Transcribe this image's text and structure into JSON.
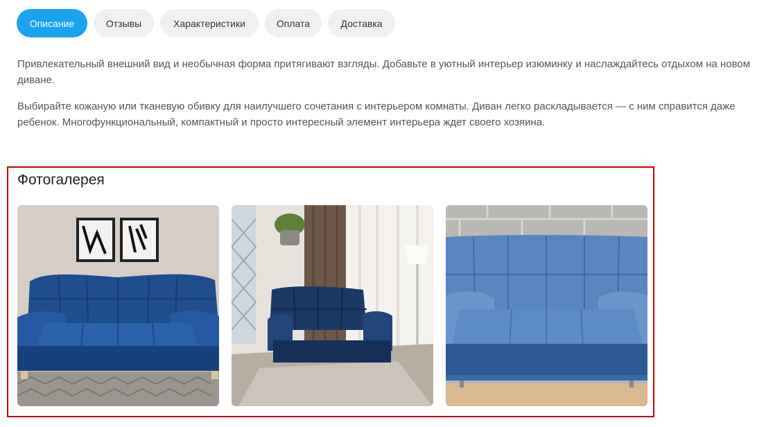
{
  "tabs": [
    {
      "label": "Описание",
      "active": true
    },
    {
      "label": "Отзывы",
      "active": false
    },
    {
      "label": "Характеристики",
      "active": false
    },
    {
      "label": "Оплата",
      "active": false
    },
    {
      "label": "Доставка",
      "active": false
    }
  ],
  "description": {
    "paragraphs": [
      "Привлекательный внешний вид и необычная форма притягивают взгляды. Добавьте в уютный интерьер изюминку и наслаждайтесь отдыхом на новом диване.",
      "Выбирайте кожаную или тканевую обивку для наилучшего сочетания с интерьером комнаты. Диван легко раскладывается — с ним справится даже ребенок. Многофункциональный, компактный и просто интересный элемент интерьера ждет своего хозяина."
    ]
  },
  "gallery": {
    "title": "Фотогалерея",
    "photos": [
      {
        "subject": "blue sofa in room with framed pictures"
      },
      {
        "subject": "blue sofa near window with curtains"
      },
      {
        "subject": "light blue sofa against brick wall"
      }
    ]
  },
  "colors": {
    "accent": "#1aa3f0",
    "highlight_border": "#c40000",
    "tab_bg": "#f0f0f0"
  }
}
